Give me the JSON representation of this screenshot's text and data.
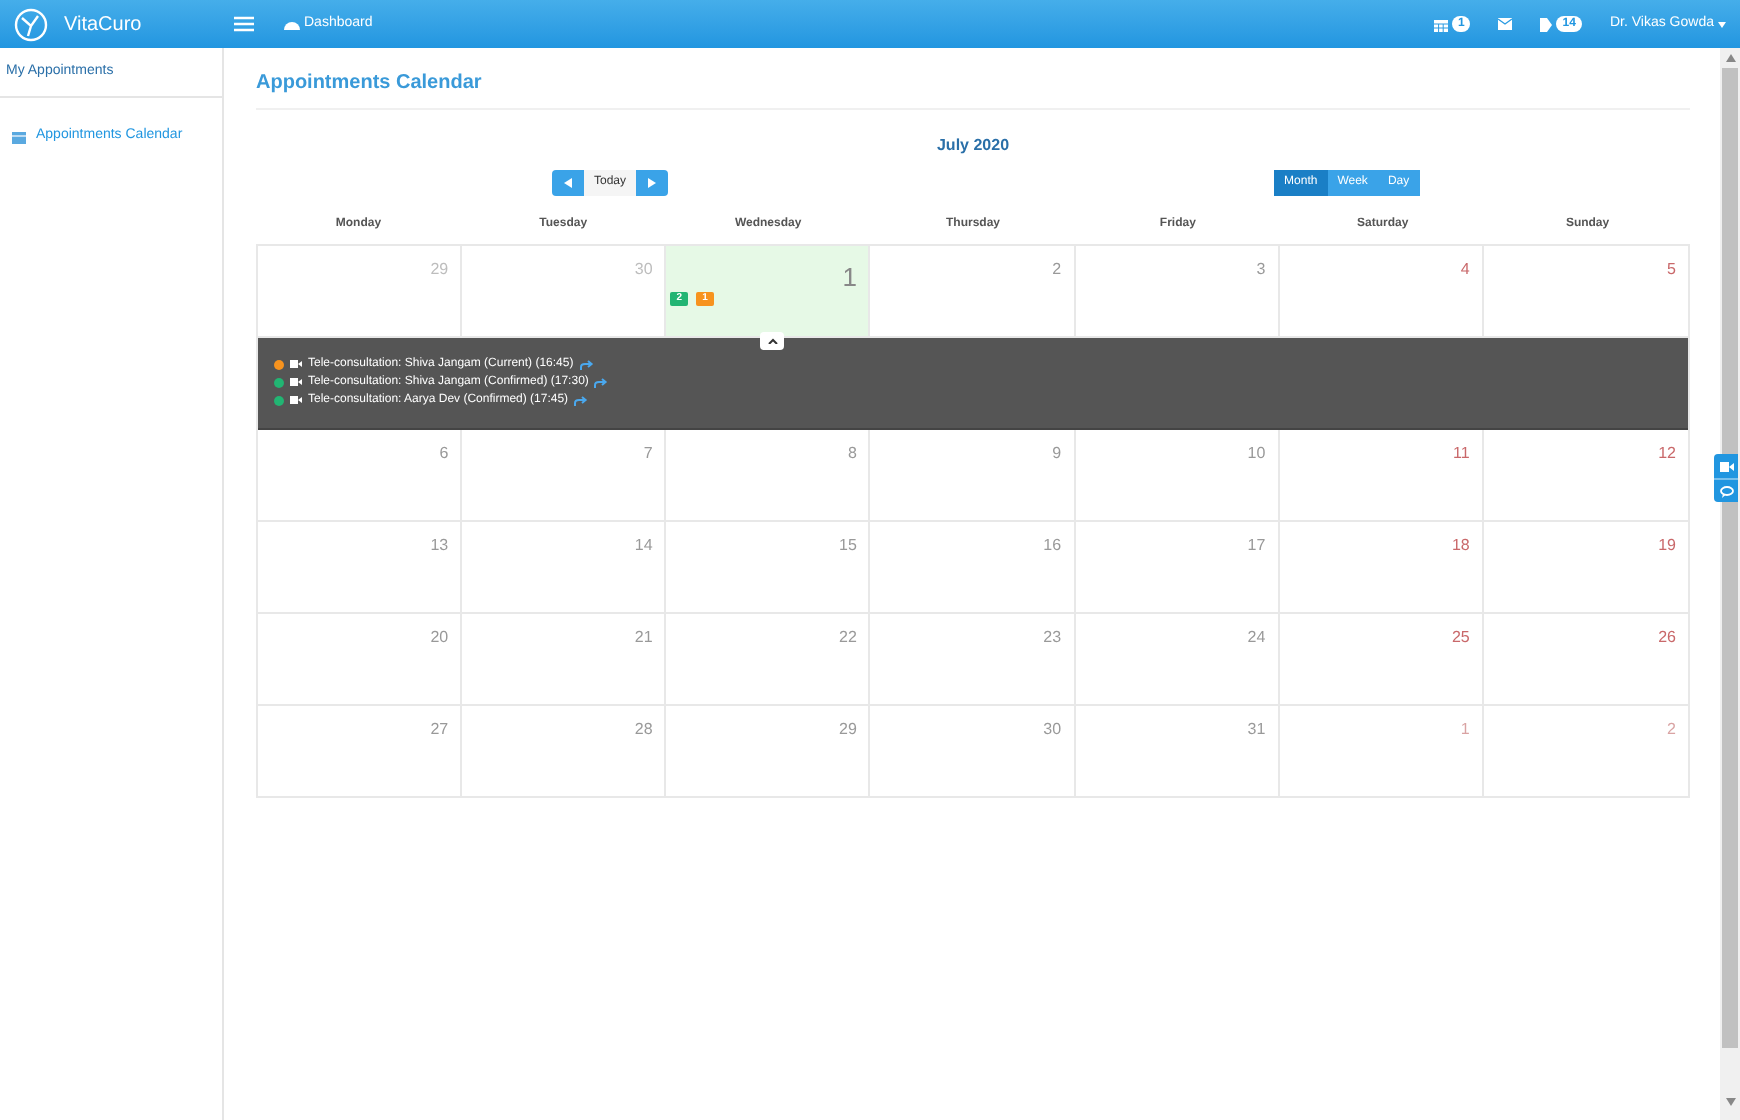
{
  "header": {
    "brand": "VitaCuro",
    "nav_link": "Dashboard",
    "calendar_badge": "1",
    "messages_badge": "14",
    "user": "Dr. Vikas Gowda"
  },
  "sidebar": {
    "heading": "My Appointments",
    "items": [
      {
        "label": "Appointments Calendar",
        "selected": true
      }
    ]
  },
  "page_title": "Appointments Calendar",
  "calendar": {
    "month": "July 2020",
    "today_button": "Today",
    "views": [
      {
        "label": "Month",
        "selected": true
      },
      {
        "label": "Week",
        "selected": false
      },
      {
        "label": "Day",
        "selected": false
      }
    ],
    "weekdays": [
      "Monday",
      "Tuesday",
      "Wednesday",
      "Thursday",
      "Friday",
      "Saturday",
      "Sunday"
    ],
    "weeks": [
      {
        "days": [
          {
            "number": "29",
            "muted": true,
            "today": false
          },
          {
            "number": "30",
            "muted": true,
            "today": false
          },
          {
            "number": "1",
            "muted": false,
            "today": true,
            "badges": [
              {
                "count": "2",
                "color": "#22b573"
              },
              {
                "count": "1",
                "color": "#f7931e"
              }
            ]
          },
          {
            "number": "2",
            "muted": false,
            "today": false
          },
          {
            "number": "3",
            "muted": false,
            "today": false
          },
          {
            "number": "4",
            "muted": false,
            "today": false
          },
          {
            "number": "5",
            "muted": false,
            "today": false
          }
        ],
        "events": [
          {
            "text": "Tele-consultation: Shiva Jangam (Current) (16:45)",
            "color": "#f7931e"
          },
          {
            "text": "Tele-consultation: Shiva Jangam (Confirmed) (17:30)",
            "color": "#22b573"
          },
          {
            "text": "Tele-consultation: Aarya Dev (Confirmed) (17:45)",
            "color": "#22b573"
          }
        ]
      },
      {
        "days": [
          {
            "number": "6",
            "muted": false,
            "today": false
          },
          {
            "number": "7",
            "muted": false,
            "today": false
          },
          {
            "number": "8",
            "muted": false,
            "today": false
          },
          {
            "number": "9",
            "muted": false,
            "today": false
          },
          {
            "number": "10",
            "muted": false,
            "today": false
          },
          {
            "number": "11",
            "muted": false,
            "today": false
          },
          {
            "number": "12",
            "muted": false,
            "today": false
          }
        ]
      },
      {
        "days": [
          {
            "number": "13",
            "muted": false,
            "today": false
          },
          {
            "number": "14",
            "muted": false,
            "today": false
          },
          {
            "number": "15",
            "muted": false,
            "today": false
          },
          {
            "number": "16",
            "muted": false,
            "today": false
          },
          {
            "number": "17",
            "muted": false,
            "today": false
          },
          {
            "number": "18",
            "muted": false,
            "today": false
          },
          {
            "number": "19",
            "muted": false,
            "today": false
          }
        ]
      },
      {
        "days": [
          {
            "number": "20",
            "muted": false,
            "today": false
          },
          {
            "number": "21",
            "muted": false,
            "today": false
          },
          {
            "number": "22",
            "muted": false,
            "today": false
          },
          {
            "number": "23",
            "muted": false,
            "today": false
          },
          {
            "number": "24",
            "muted": false,
            "today": false
          },
          {
            "number": "25",
            "muted": false,
            "today": false
          },
          {
            "number": "26",
            "muted": false,
            "today": false
          }
        ]
      },
      {
        "days": [
          {
            "number": "27",
            "muted": false,
            "today": false
          },
          {
            "number": "28",
            "muted": false,
            "today": false
          },
          {
            "number": "29",
            "muted": false,
            "today": false
          },
          {
            "number": "30",
            "muted": false,
            "today": false
          },
          {
            "number": "31",
            "muted": false,
            "today": false
          },
          {
            "number": "1",
            "muted": true,
            "today": false
          },
          {
            "number": "2",
            "muted": true,
            "today": false
          }
        ]
      }
    ]
  }
}
